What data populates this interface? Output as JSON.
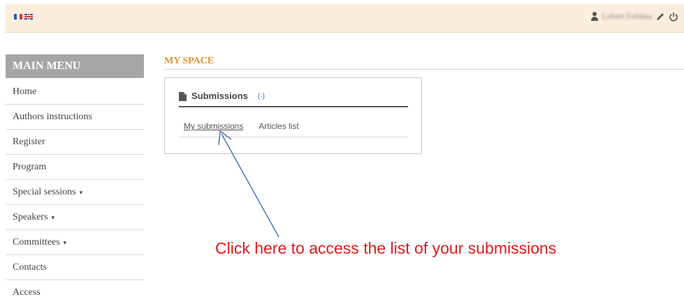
{
  "topbar": {
    "flags": [
      "flag-fr-icon",
      "flag-uk-icon"
    ],
    "user_name": "Lebert Foldina",
    "icons": [
      "user-icon",
      "pencil-icon",
      "power-icon"
    ]
  },
  "sidebar": {
    "header": "MAIN MENU",
    "items": [
      {
        "label": "Home",
        "dropdown": false
      },
      {
        "label": "Authors instructions",
        "dropdown": false
      },
      {
        "label": "Register",
        "dropdown": false
      },
      {
        "label": "Program",
        "dropdown": false
      },
      {
        "label": "Special sessions",
        "dropdown": true
      },
      {
        "label": "Speakers",
        "dropdown": true
      },
      {
        "label": "Committees",
        "dropdown": true
      },
      {
        "label": "Contacts",
        "dropdown": false
      },
      {
        "label": "Access",
        "dropdown": false
      }
    ],
    "caret": "▾"
  },
  "main": {
    "section_title": "MY SPACE",
    "panel": {
      "title": "Submissions",
      "toggle": "(-)",
      "links": [
        "My submissions",
        "Articles list"
      ]
    }
  },
  "annotation": {
    "text": "Click here to access the list of your submissions",
    "color": "#e01b1b",
    "arrow_color": "#4a76b8"
  },
  "colors": {
    "topbar_bg": "#fbeddb",
    "menu_header_bg": "#a6a6a6",
    "section_title": "#e1902f"
  }
}
